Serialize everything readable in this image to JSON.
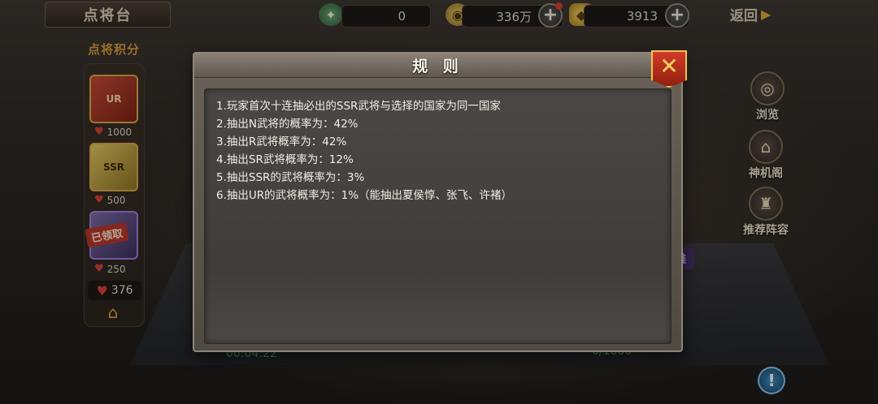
{
  "header": {
    "title": "点将台",
    "back_label": "返回",
    "resources": {
      "token": "0",
      "coins": "336万",
      "gold": "3913"
    }
  },
  "points": {
    "title": "点将积分",
    "rewards": [
      {
        "tag": "UR",
        "cost": "1000"
      },
      {
        "tag": "SSR",
        "cost": "500"
      },
      {
        "tag": "",
        "cost": "250",
        "claimed_label": "已领取"
      }
    ],
    "total": "376"
  },
  "side_menu": {
    "browse": "浏览",
    "pavilion": "神机阁",
    "recommend": "推荐阵容"
  },
  "bottom": {
    "timer": "00:04:22",
    "progress": "0/1000"
  },
  "rules_dialog": {
    "title": "规 则",
    "lines": [
      "1.玩家首次十连抽必出的SSR武将与选择的国家为同一国家",
      "2.抽出N武将的概率为：42%",
      "3.抽出R武将概率为：42%",
      "4.抽出SR武将概率为：12%",
      "5.抽出SSR的武将概率为：3%",
      "6.抽出UR的武将概率为：1%（能抽出夏侯惇、张飞、许褚）"
    ]
  },
  "colors": {
    "accent_gold": "#e0a43a",
    "close_red": "#d23b2a",
    "heart_red": "#d8413a",
    "timer_green": "#49a861"
  }
}
